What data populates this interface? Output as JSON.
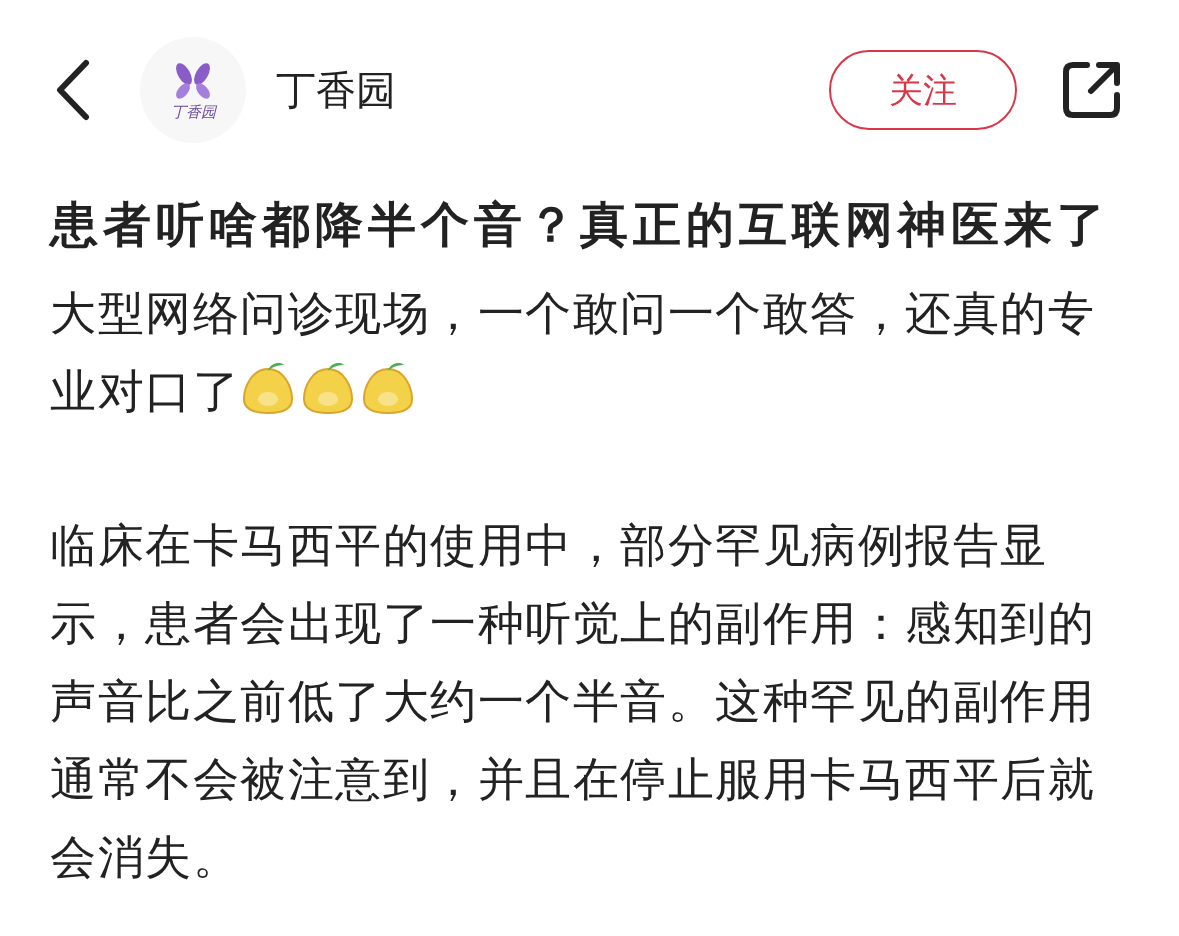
{
  "header": {
    "logo_text": "丁香园",
    "account_name": "丁香园",
    "follow_button": "关注"
  },
  "article": {
    "title": "患者听啥都降半个音？真正的互联网神医来了",
    "paragraphs": [
      {
        "text": "大型网络问诊现场，一个敢问一个敢答，还真的专业对口了",
        "stickers": [
          {
            "kind": "sticker"
          },
          {
            "kind": "sticker"
          },
          {
            "kind": "sticker"
          }
        ]
      },
      {
        "text": "临床在卡马西平的使用中，部分罕见病例报告显示，患者会出现了一种听觉上的副作用：感知到的声音比之前低了大约一个半音。这种罕见的副作用通常不会被注意到，并且在停止服用卡马西平后就会消失。"
      }
    ]
  }
}
